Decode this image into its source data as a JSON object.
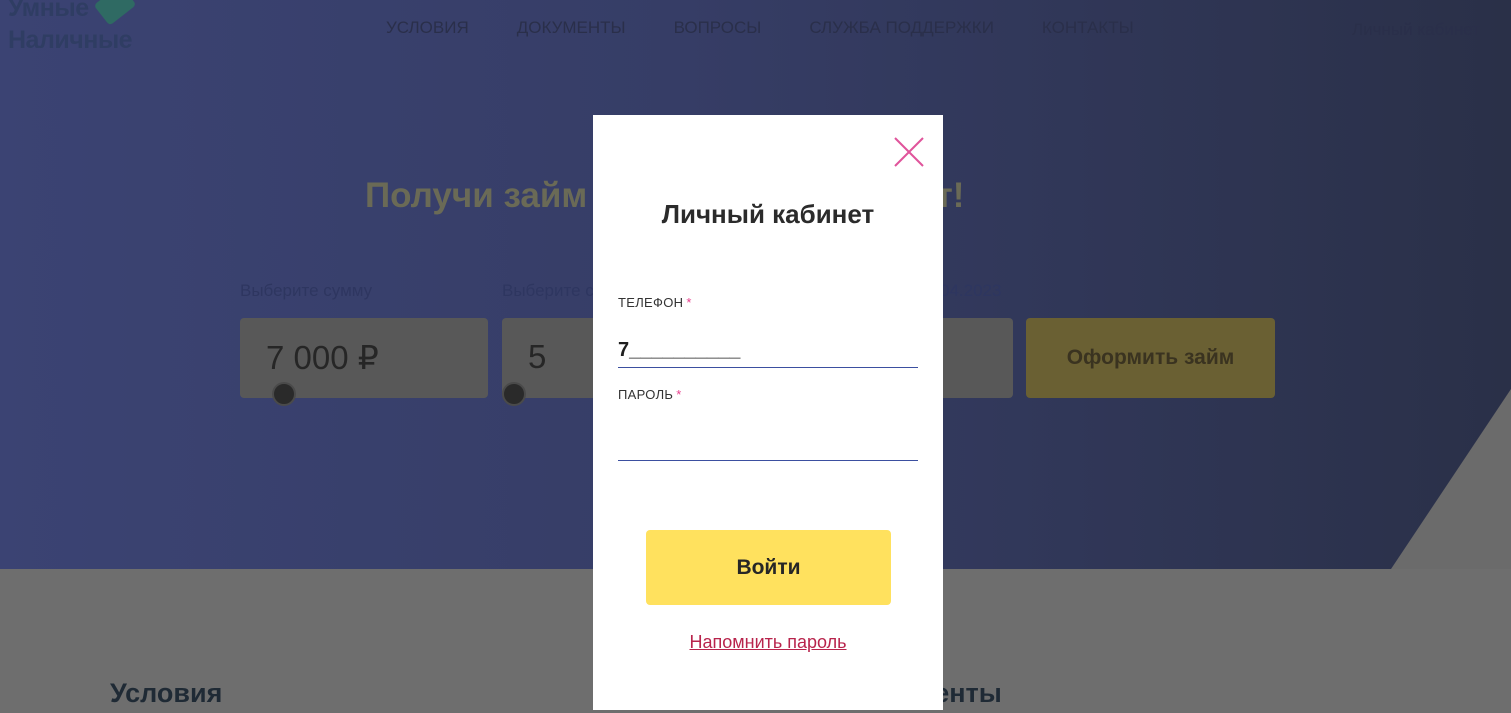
{
  "header": {
    "logo_line1": "Умные",
    "logo_line2": "Наличные",
    "nav": [
      "УСЛОВИЯ",
      "ДОКУМЕНТЫ",
      "ВОПРОСЫ",
      "СЛУЖБА ПОДДЕРЖКИ",
      "КОНТАКТЫ"
    ],
    "cabinet_link": "Личный кабинет"
  },
  "hero": {
    "title": "Получи займ на карту за 15 минут!",
    "amount_label": "Выберите сумму",
    "amount_value": "7 000 ₽",
    "term_label": "Выберите срок",
    "term_value": "5",
    "date_fragment": "04.2023",
    "apply_button": "Оформить займ"
  },
  "sections": {
    "conditions": "Условия",
    "documents": "Документы"
  },
  "modal": {
    "title": "Личный кабинет",
    "phone_label": "ТЕЛЕФОН",
    "phone_value": "7__________",
    "password_label": "ПАРОЛЬ",
    "required_mark": "*",
    "submit_label": "Войти",
    "remind_link": "Напомнить пароль"
  },
  "colors": {
    "accent_pink": "#e83e8c",
    "button_yellow": "#ffe15e",
    "link_red": "#b8244c",
    "input_underline": "#3b4fa0"
  }
}
